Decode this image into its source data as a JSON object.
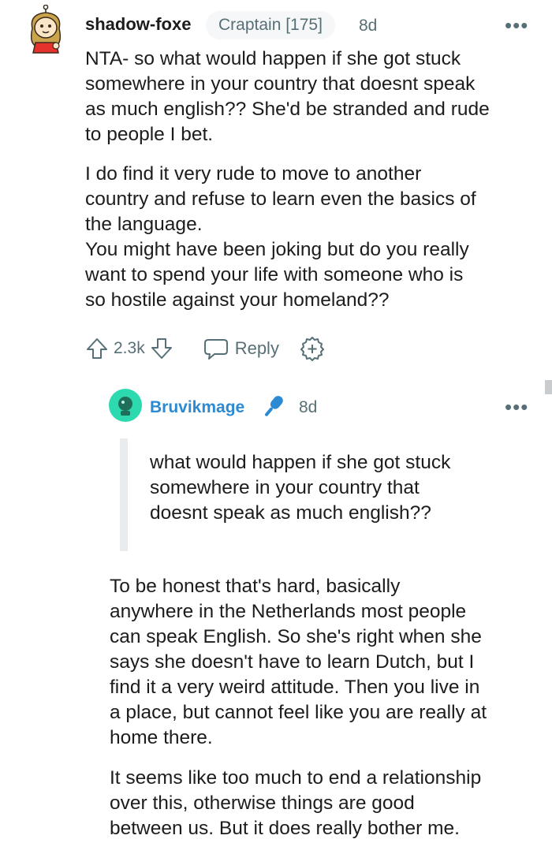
{
  "comment": {
    "username": "shadow-foxe",
    "flair": "Craptain [175]",
    "age": "8d",
    "more_icon": "•••",
    "paragraphs": [
      [
        "NTA- so what would happen if she got stuck",
        "somewhere in your country that doesnt speak",
        "as much english?? She'd be stranded and rude",
        "to people I bet."
      ],
      [
        "I do find it very rude to move to another",
        "country and refuse to learn even the basics of",
        "the language.",
        "You might have been joking but do you really",
        "want to spend your life with someone who is",
        "so hostile against your homeland??"
      ]
    ],
    "vote_count": "2.3k",
    "reply_label": "Reply",
    "icons": [
      "upvote-icon",
      "downvote-icon",
      "reply-icon",
      "award-icon"
    ]
  },
  "reply": {
    "username": "Bruvikmage",
    "age": "8d",
    "more_icon": "•••",
    "badge_icon": "microphone-icon",
    "quote": [
      "what would happen if she got stuck",
      "somewhere in your country that",
      "doesnt speak as much english??"
    ],
    "paragraphs": [
      [
        "To be honest that's hard, basically",
        "anywhere in the Netherlands most people",
        "can speak English. So she's right when she",
        "says she doesn't have to learn Dutch, but I",
        "find it a very weird attitude. Then you live in",
        "a place, but cannot feel like you are really at",
        "home there."
      ],
      [
        "It seems like too much to end a relationship",
        "over this, otherwise things are good",
        "between us. But it does really bother me."
      ]
    ]
  },
  "colors": {
    "text": "#1c1c1c",
    "meta": "#576f76",
    "link_blue": "#2b8ad1",
    "avatar_teal": "#2ddab0"
  }
}
